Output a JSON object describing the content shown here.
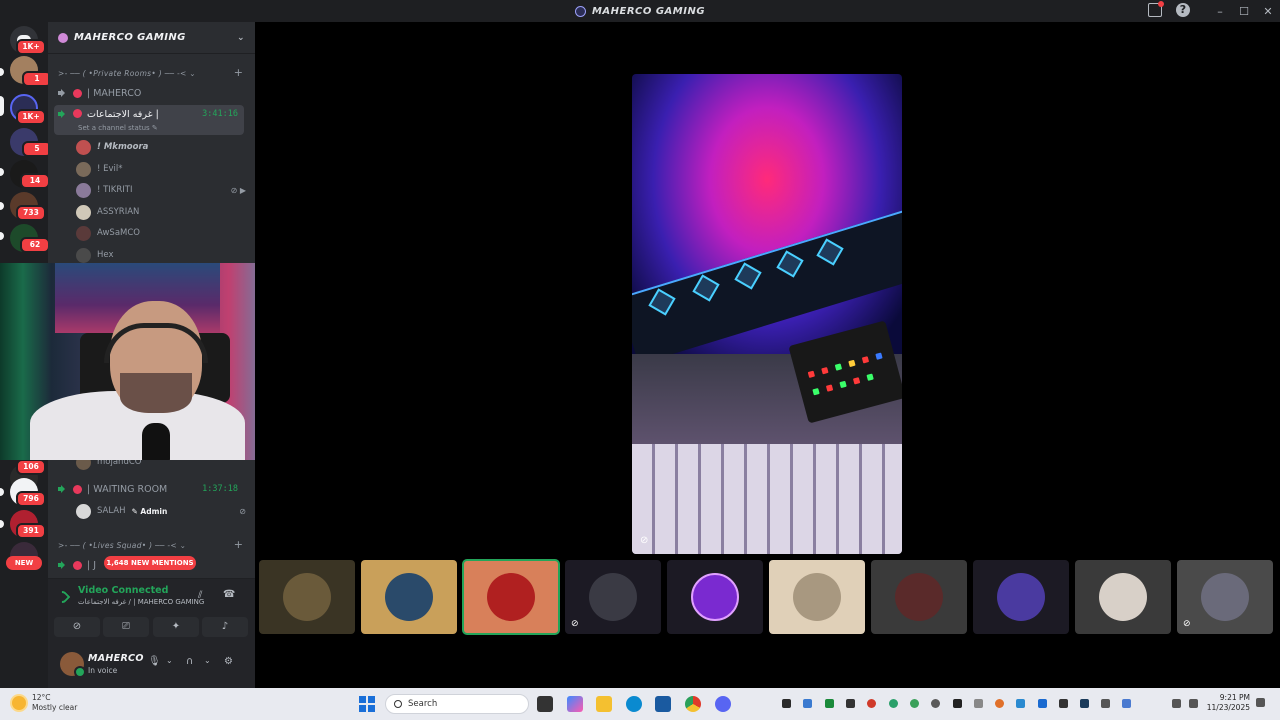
{
  "window": {
    "title": "MAHERCO GAMING"
  },
  "guild": {
    "name": "MAHERCO GAMING"
  },
  "rail": {
    "badges": [
      "1K+",
      "1",
      "1K+",
      "5",
      "14",
      "733",
      "62",
      "106",
      "796",
      "391"
    ]
  },
  "channels": {
    "private_category": ">- ── ( •Private Rooms• ) ── -< ⌄",
    "ch1": {
      "name": "| MAHERCO"
    },
    "ch2": {
      "name": "| غرفه الاجتماعات",
      "timer": "3:41:16",
      "status": "Set a channel status ✎"
    },
    "members": [
      {
        "name": "! Mkmoora"
      },
      {
        "name": "! Evil*"
      },
      {
        "name": "! TIKRITI"
      },
      {
        "name": "ASSYRIAN"
      },
      {
        "name": "AwSaMCO"
      },
      {
        "name": "Hex"
      },
      {
        "name": "mojahdCO"
      }
    ],
    "waiting": {
      "name": "| WAITING ROOM",
      "timer": "1:37:18"
    },
    "waiting_member": {
      "name": "SALAH",
      "tag": "✎ Admin"
    },
    "lives_category": ">- ── ( •Lives Squad• ) ── -< ⌄",
    "partial": "| J"
  },
  "pills": {
    "new": "NEW",
    "mentions": "1,648 NEW MENTIONS"
  },
  "rtc": {
    "status": "Video Connected",
    "sub": "غرفه الاجتماعات / | MAHERCO GAMING"
  },
  "user": {
    "name": "MAHERCO",
    "status": "In voice"
  },
  "taskbar": {
    "temp": "12°C",
    "weather": "Mostly clear",
    "search_placeholder": "Search",
    "time": "9:21 PM",
    "date": "11/23/2025"
  },
  "colors": {
    "green": "#23a55a",
    "red": "#f23f43",
    "blurple": "#5865f2"
  }
}
